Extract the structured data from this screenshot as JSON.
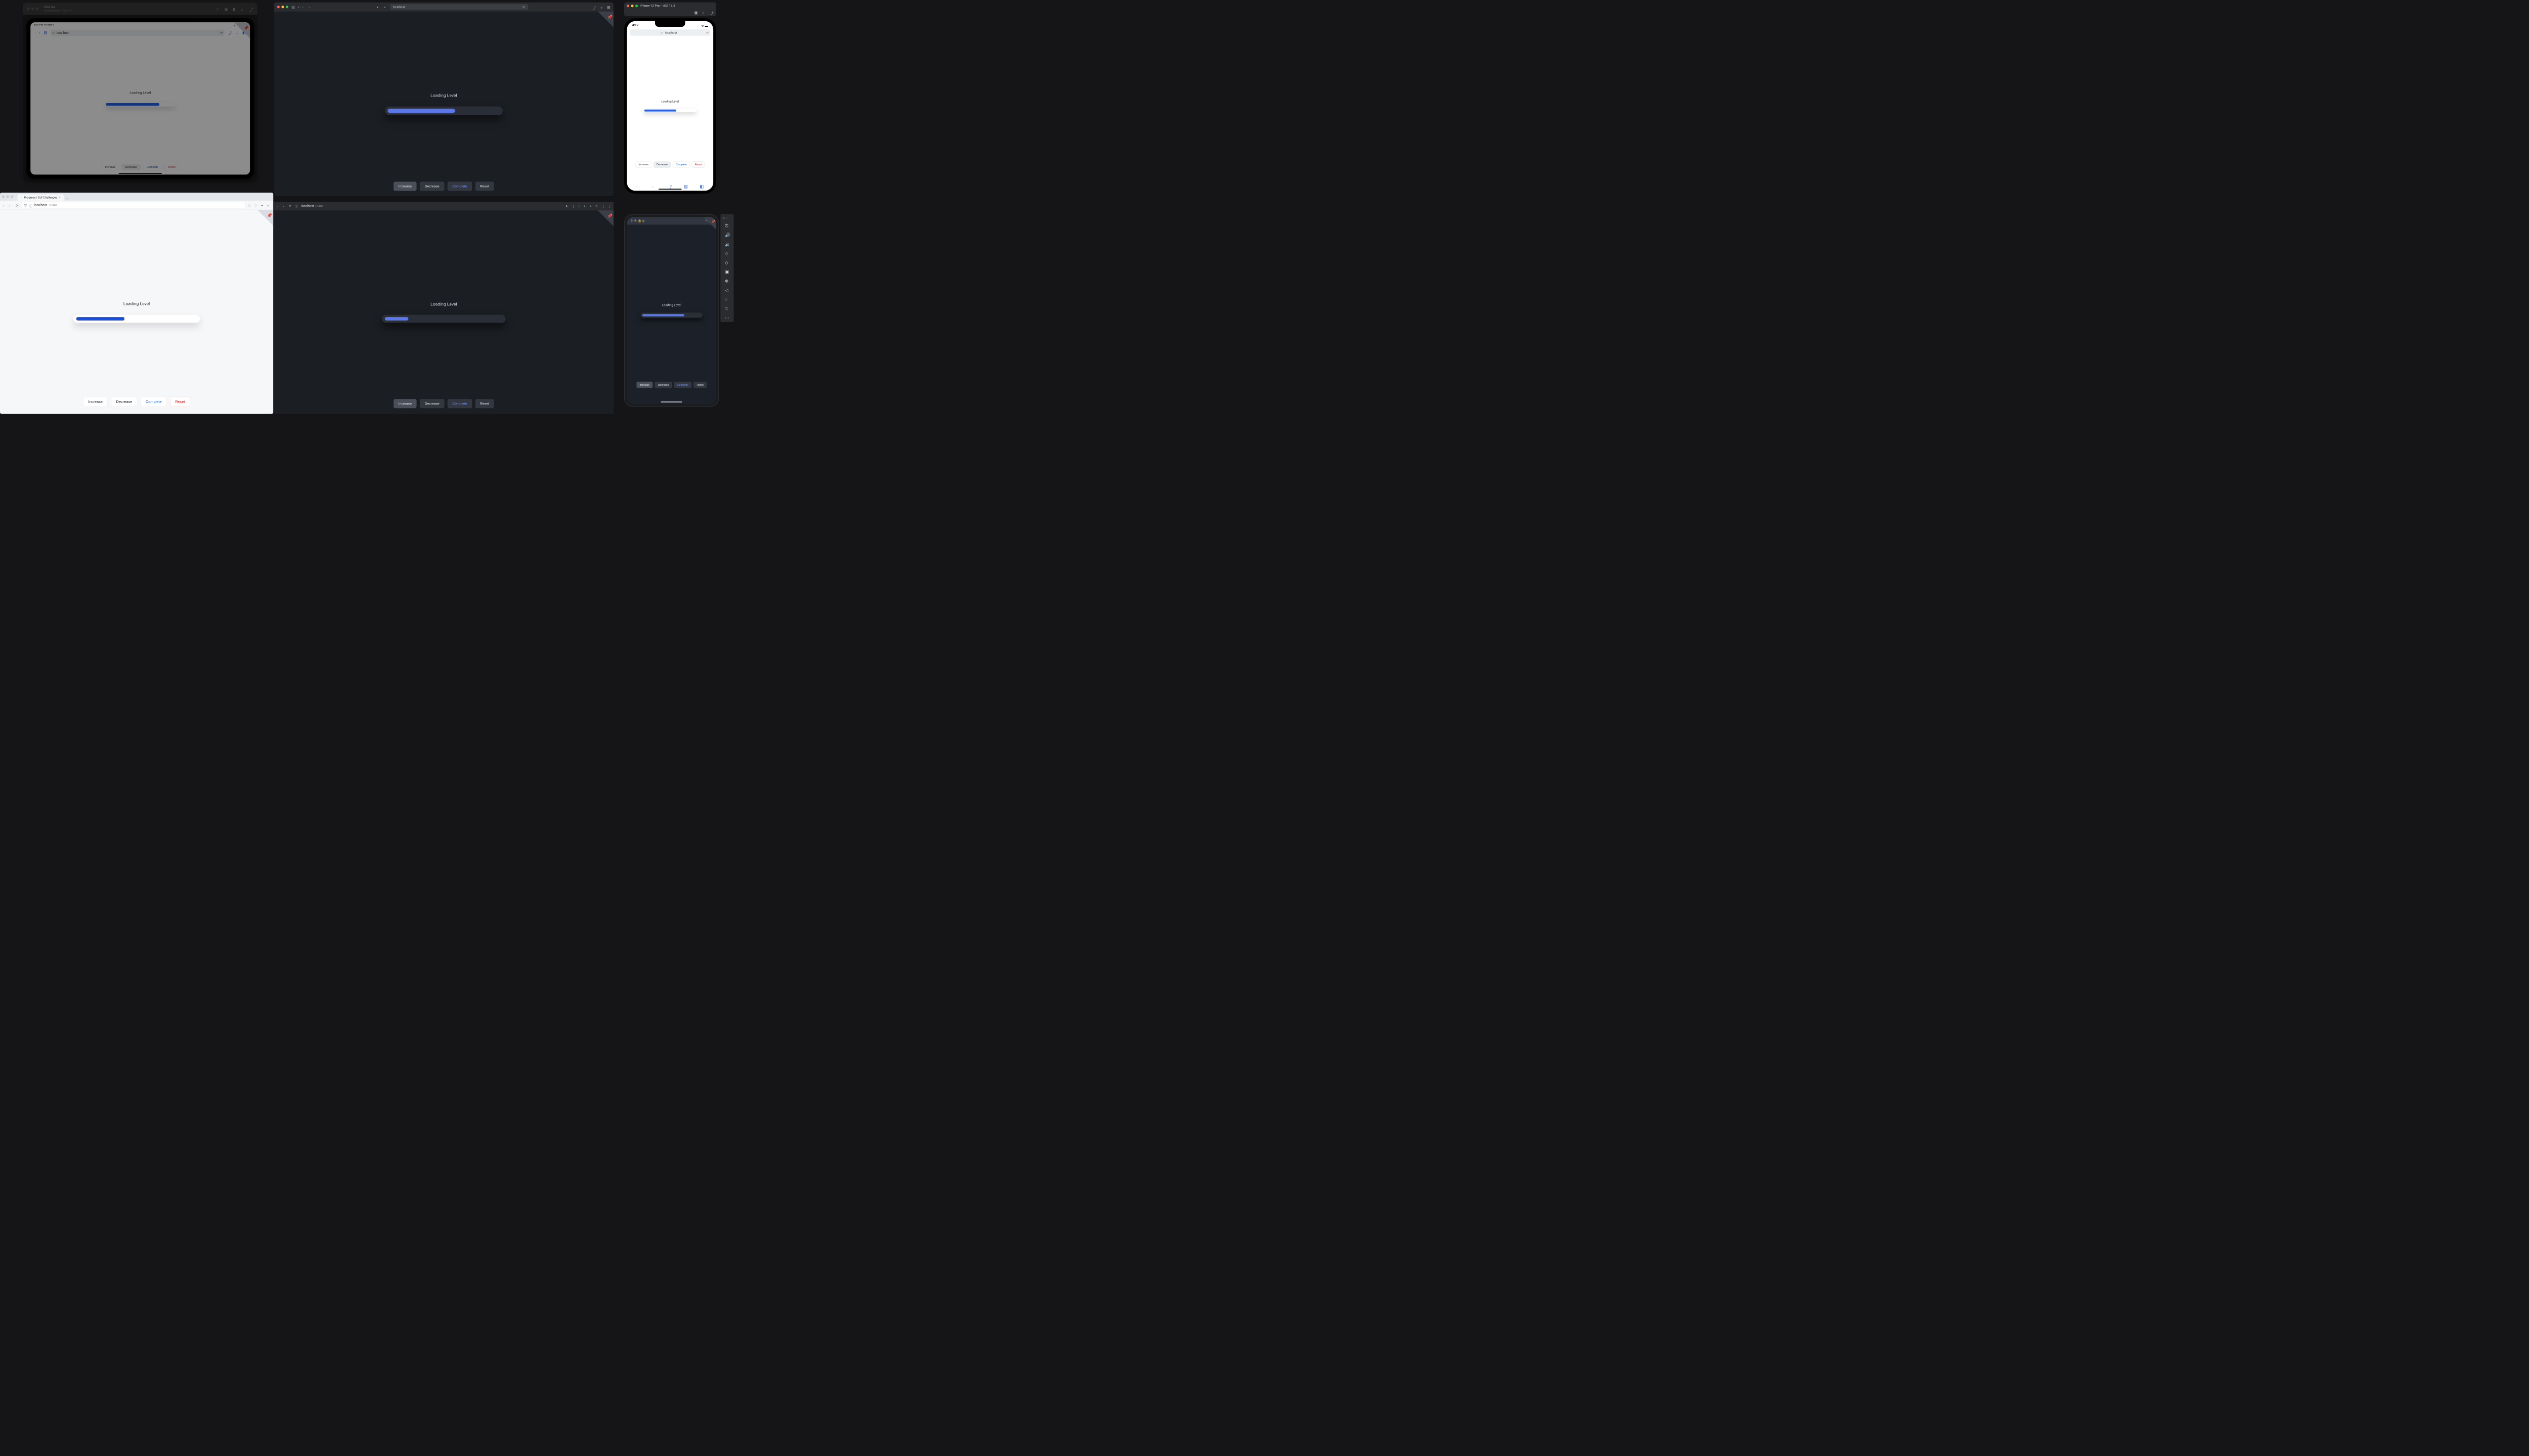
{
  "app": {
    "loading_label": "Loading Level",
    "buttons": {
      "increase": "Increase",
      "decrease": "Decrease",
      "complete": "Complete",
      "reset": "Reset"
    }
  },
  "ipad": {
    "title": "iPad Air",
    "subtitle": "4th generation – iOS 14.5",
    "status_time": "8:19 PM",
    "status_date": "Fri Mar 4",
    "wifi": "100%",
    "address": "localhost",
    "progress_pct": 78
  },
  "safari": {
    "address": "localhost",
    "progress_pct": 60
  },
  "iphone": {
    "title": "iPhone 12 Pro – iOS 14.5",
    "status_time": "3:19",
    "address": "localhost",
    "progress_pct": 62
  },
  "firefox": {
    "tab_title": "Progress | GUI Challenges",
    "host": "localhost",
    "port": ":3000",
    "progress_pct": 40
  },
  "chrome": {
    "host": "localhost",
    "port": ":3000",
    "progress_pct": 20
  },
  "android": {
    "status_time": "3:19",
    "progress_pct": 72
  },
  "colors": {
    "accent_light": "#2563eb",
    "accent_dark": "#5b77e8",
    "danger": "#dc2626"
  }
}
